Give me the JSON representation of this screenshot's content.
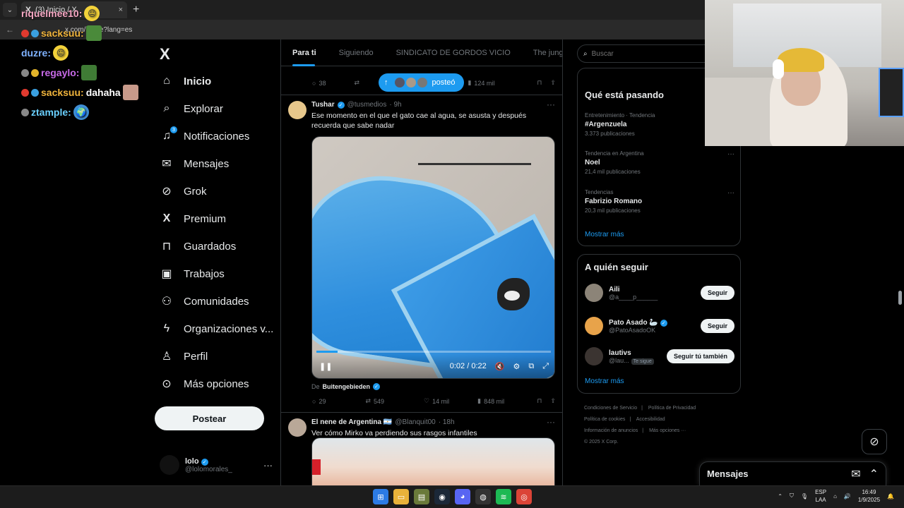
{
  "browser": {
    "tab_logo": "X",
    "tab_title": "(3) Inicio / X",
    "tab_close": "×",
    "new_tab": "+",
    "address": "x.com/home?lang=es"
  },
  "chat": [
    {
      "user": "riquelmee10:",
      "color": "#f7a8c4",
      "msg": ""
    },
    {
      "user": "sacksuu:",
      "color": "#f0b43c",
      "msg": ""
    },
    {
      "user": "duzre:",
      "color": "#7fb2ff",
      "msg": ""
    },
    {
      "user": "regaylo:",
      "color": "#c86ae8",
      "msg": ""
    },
    {
      "user": "sacksuu:",
      "color": "#f0b43c",
      "msg": "dahaha"
    },
    {
      "user": "ztample:",
      "color": "#6ad0ff",
      "msg": ""
    }
  ],
  "nav": {
    "brand": "X",
    "notif_count": "3",
    "items": [
      {
        "label": "Inicio",
        "icon": "home-icon",
        "glyph": "⌂"
      },
      {
        "label": "Explorar",
        "icon": "search-icon",
        "glyph": "⌕"
      },
      {
        "label": "Notificaciones",
        "icon": "bell-icon",
        "glyph": "🔔"
      },
      {
        "label": "Mensajes",
        "icon": "envelope-icon",
        "glyph": "✉"
      },
      {
        "label": "Grok",
        "icon": "grok-icon",
        "glyph": "⊘"
      },
      {
        "label": "Premium",
        "icon": "x-premium-icon",
        "glyph": "X"
      },
      {
        "label": "Guardados",
        "icon": "bookmark-icon",
        "glyph": "⊓"
      },
      {
        "label": "Trabajos",
        "icon": "briefcase-icon",
        "glyph": "▣"
      },
      {
        "label": "Comunidades",
        "icon": "communities-icon",
        "glyph": "⚇"
      },
      {
        "label": "Organizaciones v...",
        "icon": "lightning-icon",
        "glyph": "⚡"
      },
      {
        "label": "Perfil",
        "icon": "person-icon",
        "glyph": "♙"
      },
      {
        "label": "Más opciones",
        "icon": "more-circle-icon",
        "glyph": "⊙"
      }
    ],
    "post_button": "Postear",
    "profile_name": "lolo",
    "profile_handle": "@lolomorales_",
    "profile_more": "···"
  },
  "feed": {
    "tabs": [
      "Para ti",
      "Siguiendo",
      "SINDICATO DE GORDOS VICIO",
      "The jungle"
    ],
    "pill_label": "posteó",
    "prev_actions": {
      "replies": "38",
      "retweets": "",
      "views": "124 mil"
    },
    "tweet1": {
      "name": "Tushar",
      "handle": "@tusmedios",
      "time": "· 9h",
      "text": "Ese momento en el que el gato cae al agua, se asusta y después recuerda que sabe nadar",
      "video_time": "0:02 / 0:22",
      "video_progress": 0.09,
      "source_prefix": "De",
      "source_name": "Buitengebieden",
      "replies": "29",
      "retweets": "549",
      "likes": "14 mil",
      "views": "848 mil"
    },
    "tweet2": {
      "name": "El nene de Argentina 🇦🇷",
      "handle": "@Blanquit00",
      "time": "· 18h",
      "text": "Ver cómo Mirko va perdiendo sus rasgos infantiles"
    }
  },
  "right": {
    "search_placeholder": "Buscar",
    "trends_title": "Qué está pasando",
    "trends": [
      {
        "category": "Entretenimiento · Tendencia",
        "name": "#Argenzuela",
        "count": "3.373 publicaciones"
      },
      {
        "category": "Tendencia en Argentina",
        "name": "Noel",
        "count": "21,4 mil publicaciones"
      },
      {
        "category": "Tendencias",
        "name": "Fabrizio Romano",
        "count": "20,3 mil publicaciones"
      }
    ],
    "show_more": "Mostrar más",
    "follow_title": "A quién seguir",
    "follows": [
      {
        "name": "Aili",
        "handle": "@a____p______",
        "button": "Seguir",
        "tag": ""
      },
      {
        "name": "Pato Asado 🦢",
        "handle": "@PatoAsadoOK",
        "button": "Seguir",
        "tag": ""
      },
      {
        "name": "lautivs",
        "handle": "@lau...",
        "button": "Seguir tú también",
        "tag": "Te sigue"
      }
    ],
    "follow_more": "Mostrar más",
    "footer": [
      "Condiciones de Servicio",
      "Política de Privacidad",
      "Política de cookies",
      "Accesibilidad",
      "Información de anuncios",
      "Más opciones ···",
      "© 2025 X Corp."
    ],
    "messages_dock": "Mensajes"
  },
  "taskbar": {
    "lang_top": "ESP",
    "lang_bottom": "LAA",
    "time": "16:49",
    "date": "1/9/2025"
  },
  "colors": {
    "accent": "#1d9bf0",
    "bg": "#000000",
    "border": "#2f3336",
    "muted": "#71767b"
  }
}
